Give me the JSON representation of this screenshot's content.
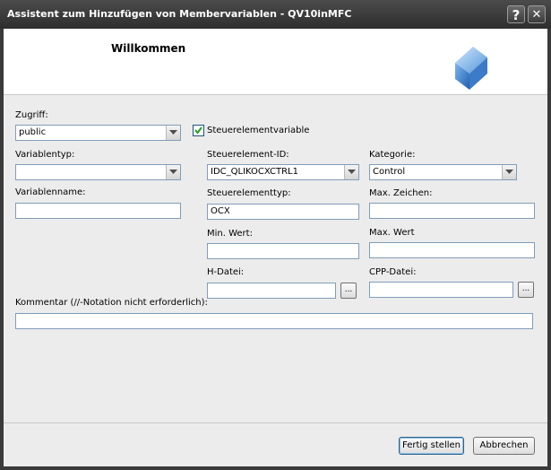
{
  "window": {
    "title": "Assistent zum Hinzufügen von Membervariablen - QV10inMFC",
    "help_label": "?",
    "close_label": "✕"
  },
  "header": {
    "welcome": "Willkommen",
    "logo_icon": "cube-icon"
  },
  "form": {
    "access_label": "Zugriff:",
    "access_value": "public",
    "control_var_label": "Steuerelementvariable",
    "control_var_checked": true,
    "vartype_label": "Variablentyp:",
    "vartype_value": "",
    "control_id_label": "Steuerelement-ID:",
    "control_id_value": "IDC_QLIKOCXCTRL1",
    "category_label": "Kategorie:",
    "category_value": "Control",
    "varname_label": "Variablenname:",
    "varname_value": "",
    "control_type_label": "Steuerelementtyp:",
    "control_type_value": "OCX",
    "max_chars_label": "Max. Zeichen:",
    "max_chars_value": "",
    "min_value_label": "Min. Wert:",
    "min_value_value": "",
    "max_value_label": "Max. Wert",
    "max_value_value": "",
    "h_file_label": "H-Datei:",
    "h_file_value": "",
    "cpp_file_label": "CPP-Datei:",
    "cpp_file_value": "",
    "browse_label": "...",
    "comment_label": "Kommentar (//-Notation nicht erforderlich):",
    "comment_value": ""
  },
  "footer": {
    "finish_label": "Fertig stellen",
    "cancel_label": "Abbrechen"
  },
  "colors": {
    "titlebar": "#3a3a3a",
    "client": "#ececec",
    "field_border": "#7f9db9"
  }
}
